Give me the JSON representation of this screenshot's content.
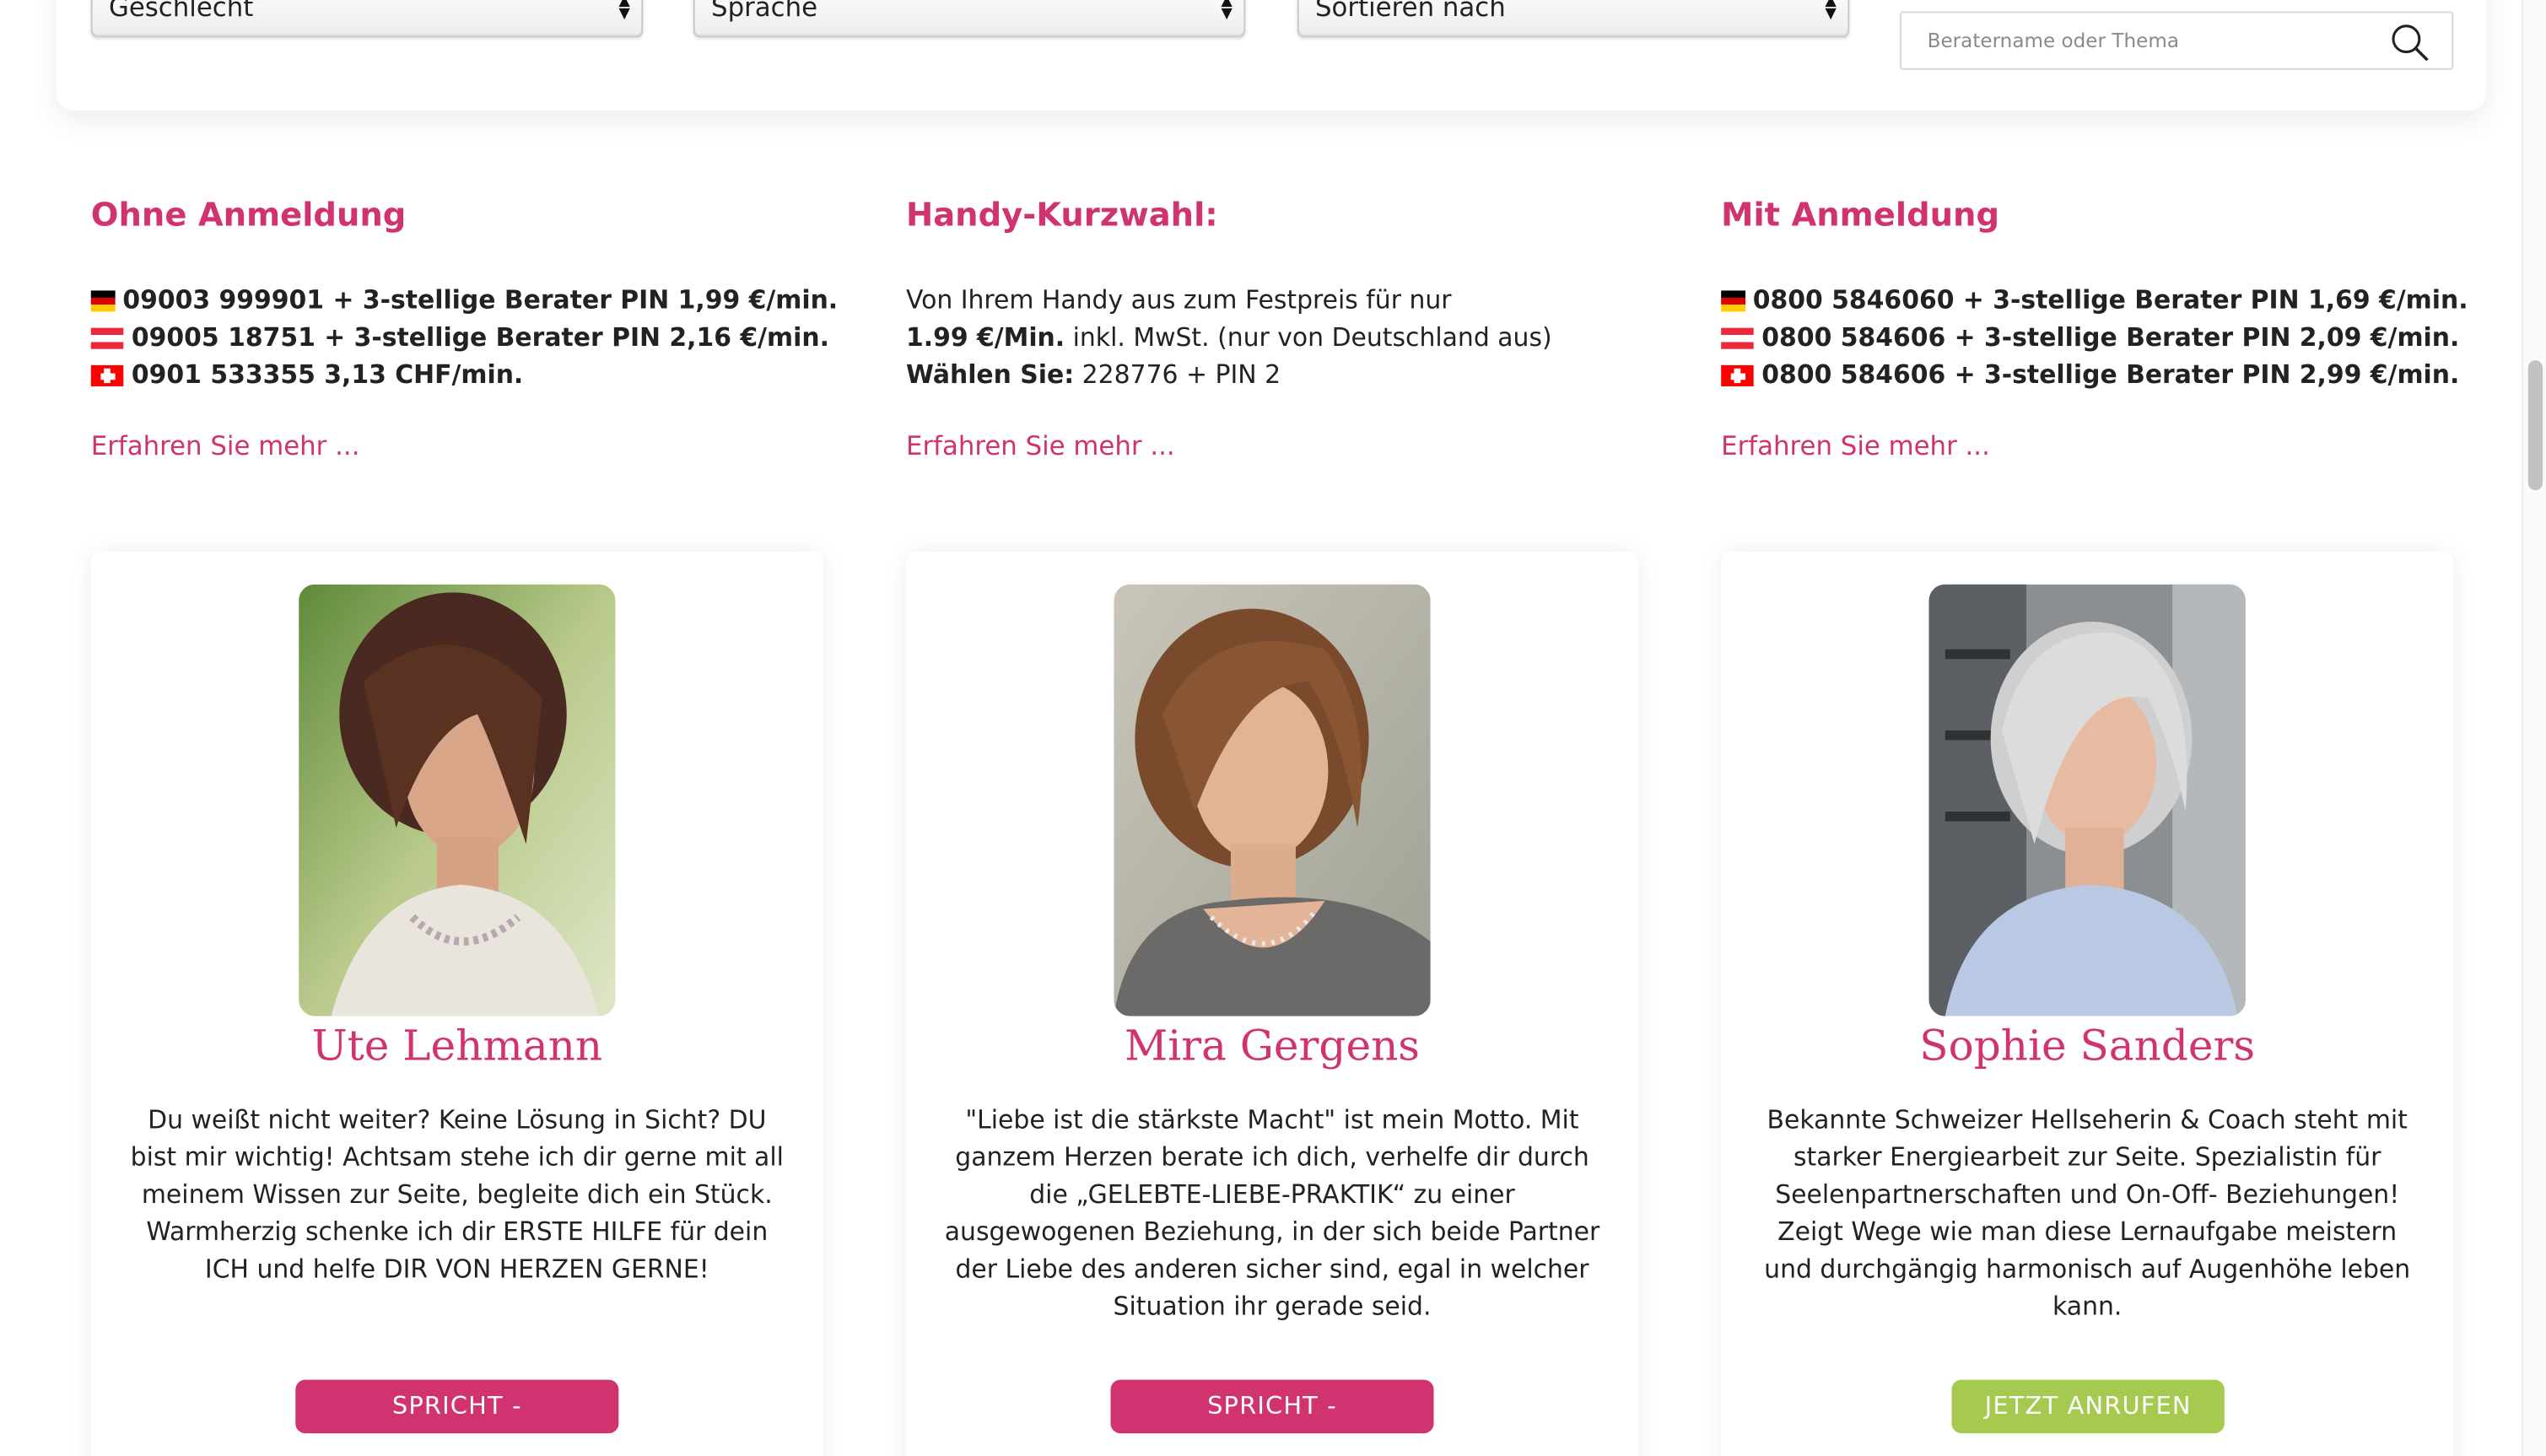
{
  "filters": {
    "gender": "Geschlecht",
    "language": "Sprache",
    "sort": "Sortieren nach",
    "search_placeholder": "Beratername oder Thema"
  },
  "columns": [
    {
      "title": "Ohne Anmeldung",
      "lines": [
        {
          "flag": "de",
          "text": "09003 999901 + 3-stellige Berater PIN 1,99 €/min."
        },
        {
          "flag": "at",
          "text": "09005 18751 + 3-stellige Berater PIN 2,16 €/min."
        },
        {
          "flag": "ch",
          "text": "0901 533355 3,13 CHF/min."
        }
      ],
      "more": "Erfahren Sie mehr ..."
    },
    {
      "title": "Handy-Kurzwahl:",
      "line1": "Von Ihrem Handy aus zum Festpreis für nur",
      "line2_bold": "1.99 €/Min.",
      "line2_rest": " inkl. MwSt. (nur von Deutschland aus)",
      "line3_bold": "Wählen Sie:",
      "line3_rest": " 228776 + PIN 2",
      "more": "Erfahren Sie mehr ..."
    },
    {
      "title": "Mit Anmeldung",
      "lines": [
        {
          "flag": "de",
          "text": "0800 5846060 + 3-stellige Berater PIN 1,69 €/min."
        },
        {
          "flag": "at",
          "text": "0800 584606 + 3-stellige Berater PIN 2,09 €/min."
        },
        {
          "flag": "ch",
          "text": "0800 584606 + 3-stellige Berater PIN 2,99 €/min."
        }
      ],
      "more": "Erfahren Sie mehr ..."
    }
  ],
  "advisors": [
    {
      "name": "Ute Lehmann",
      "description": "Du weißt nicht weiter? Keine Lösung in Sicht? DU bist mir wichtig! Achtsam stehe ich dir gerne mit all meinem Wissen zur Seite, begleite dich ein Stück. Warmherzig schenke ich dir ERSTE HILFE für dein ICH und helfe DIR VON HERZEN GERNE!",
      "button": "SPRICHT - RÜCKRUF",
      "button_color": "#d0336f"
    },
    {
      "name": "Mira Gergens",
      "description": "\"Liebe ist die stärkste Macht\" ist mein Motto. Mit ganzem Herzen berate ich dich, verhelfe dir durch die „GELEBTE-LIEBE-PRAKTIK“ zu einer ausgewogenen Beziehung, in der sich beide Partner der Liebe des anderen sicher sind, egal in welcher Situation ihr gerade seid.",
      "button": "SPRICHT - RÜCKRUF",
      "button_color": "#d0336f"
    },
    {
      "name": "Sophie Sanders",
      "description": "Bekannte Schweizer Hellseherin & Coach steht mit starker Energiearbeit zur Seite. Spezialistin für Seelenpartnerschaften und On-Off- Beziehungen! Zeigt Wege wie man diese Lernaufgabe meistern und durchgängig harmonisch auf Augenhöhe leben kann.",
      "button": "JETZT ANRUFEN",
      "button_color": "#a6c950"
    }
  ],
  "accent_color": "#d0336f",
  "icons": [
    "search-icon",
    "flag-de-icon",
    "flag-at-icon",
    "flag-ch-icon",
    "select-arrows-icon"
  ]
}
